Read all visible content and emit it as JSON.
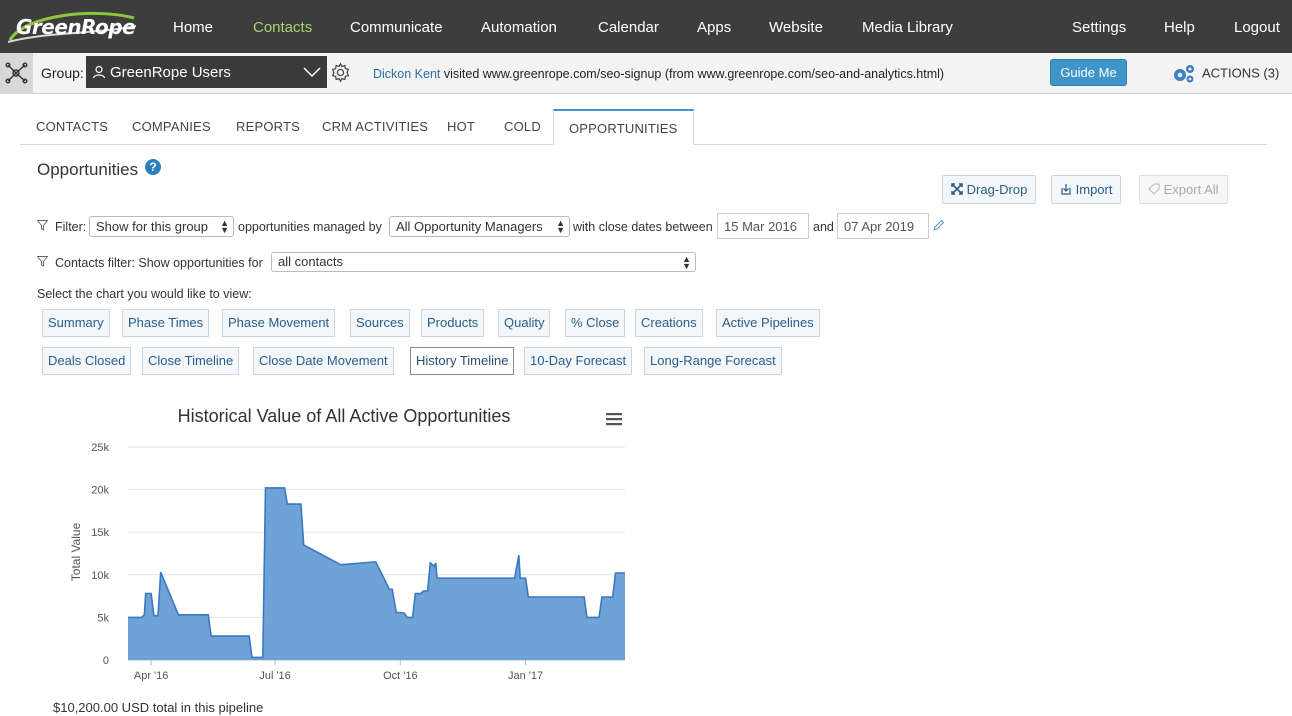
{
  "app": {
    "logo_text": "GreenRope",
    "nav": [
      "Home",
      "Contacts",
      "Communicate",
      "Automation",
      "Calendar",
      "Apps",
      "Website",
      "Media Library"
    ],
    "nav_right": [
      "Settings",
      "Help",
      "Logout"
    ],
    "active_nav": "Contacts"
  },
  "groupbar": {
    "label": "Group:",
    "group_name": "GreenRope Users",
    "visit_name": "Dickon Kent",
    "visit_text": " visited www.greenrope.com/seo-signup (from www.greenrope.com/seo-and-analytics.html)",
    "guide_label": "Guide Me",
    "actions_label": "ACTIONS (3)"
  },
  "tabs": [
    "CONTACTS",
    "COMPANIES",
    "REPORTS",
    "CRM ACTIVITIES",
    "HOT",
    "COLD",
    "OPPORTUNITIES"
  ],
  "active_tab": "OPPORTUNITIES",
  "page": {
    "title": "Opportunities",
    "help": "?",
    "buttons": {
      "drag_drop": "Drag-Drop",
      "import": "Import",
      "export": "Export All"
    }
  },
  "filter": {
    "label": "Filter:",
    "group_option": "Show for this group",
    "managed_by": "opportunities managed by",
    "manager_option": "All Opportunity Managers",
    "close_between": "with close dates between",
    "date_from": "15 Mar 2016",
    "and": "and",
    "date_to": "07 Apr 2019"
  },
  "contacts_filter": {
    "label": "Contacts filter: Show opportunities for",
    "option": "all contacts"
  },
  "chart_select": {
    "prompt": "Select the chart you would like to view:",
    "row1": [
      "Summary",
      "Phase Times",
      "Phase Movement",
      "Sources",
      "Products",
      "Quality",
      "% Close",
      "Creations",
      "Active Pipelines"
    ],
    "row2": [
      "Deals Closed",
      "Close Timeline",
      "Close Date Movement",
      "History Timeline",
      "10-Day Forecast",
      "Long-Range Forecast"
    ],
    "active": "History Timeline"
  },
  "chart_data": {
    "type": "area",
    "title": "Historical Value of All Active Opportunities",
    "xlabel": "",
    "ylabel": "Total Value",
    "ylim": [
      0,
      25000
    ],
    "yticks": [
      "0",
      "5k",
      "10k",
      "15k",
      "20k",
      "25k"
    ],
    "xticks": [
      {
        "label": "Apr '16",
        "date": "2016-04-01"
      },
      {
        "label": "Jul '16",
        "date": "2016-07-01"
      },
      {
        "label": "Oct '16",
        "date": "2016-10-01"
      },
      {
        "label": "Jan '17",
        "date": "2017-01-01"
      }
    ],
    "grid": true,
    "color": "#6fa3d8",
    "x": [
      "2016-03-15",
      "2016-03-25",
      "2016-03-27",
      "2016-03-28",
      "2016-04-01",
      "2016-04-03",
      "2016-04-06",
      "2016-04-08",
      "2016-04-21",
      "2016-04-23",
      "2016-05-13",
      "2016-05-15",
      "2016-06-01",
      "2016-06-03",
      "2016-06-12",
      "2016-06-14",
      "2016-06-16",
      "2016-06-22",
      "2016-06-24",
      "2016-07-08",
      "2016-07-10",
      "2016-07-20",
      "2016-07-22",
      "2016-08-18",
      "2016-08-20",
      "2016-09-11",
      "2016-09-13",
      "2016-09-23",
      "2016-09-25",
      "2016-09-28",
      "2016-10-04",
      "2016-10-06",
      "2016-10-10",
      "2016-10-12",
      "2016-10-16",
      "2016-10-18",
      "2016-10-21",
      "2016-10-23",
      "2016-10-26",
      "2016-10-27",
      "2016-10-28",
      "2016-11-01",
      "2016-12-24",
      "2016-12-27",
      "2016-12-28",
      "2017-01-01",
      "2017-01-03",
      "2017-01-05",
      "2017-02-13",
      "2017-02-15",
      "2017-02-24",
      "2017-02-26",
      "2017-03-06",
      "2017-03-08",
      "2017-03-15"
    ],
    "values": [
      5000,
      5000,
      5300,
      7800,
      7800,
      5200,
      5200,
      10300,
      5300,
      5300,
      5300,
      2800,
      2800,
      2800,
      2800,
      300,
      300,
      300,
      20200,
      20200,
      18300,
      18300,
      13500,
      11200,
      11200,
      11500,
      11500,
      8300,
      8300,
      5600,
      5500,
      5000,
      5000,
      7800,
      7800,
      8100,
      8100,
      11400,
      11000,
      11400,
      9600,
      9600,
      9600,
      12300,
      9600,
      9600,
      7400,
      7400,
      7400,
      5000,
      5000,
      7400,
      7400,
      10200,
      10200
    ]
  },
  "total": "$10,200.00 USD total in this pipeline"
}
